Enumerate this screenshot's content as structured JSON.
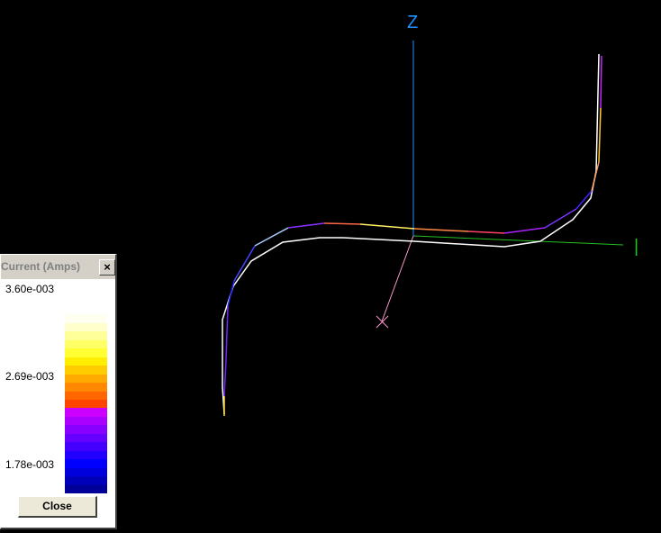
{
  "axes": {
    "z_label": "Z",
    "y_label": "Y",
    "x_label": "X",
    "z_color": "#1e90ff",
    "y_color": "#22c022",
    "x_color": "#ff99cc"
  },
  "legend": {
    "title": "Current (Amps)",
    "close_x": "×",
    "max_label": "3.60e-003",
    "mid_label": "2.69e-003",
    "min_label": "1.78e-003",
    "close_button": "Close",
    "colors_top_to_bottom": [
      "#ffffff",
      "#fffff0",
      "#ffffcc",
      "#ffff99",
      "#ffff66",
      "#ffff33",
      "#ffee00",
      "#ffcc00",
      "#ffaa00",
      "#ff8800",
      "#ff6600",
      "#ff4400",
      "#cc00ff",
      "#aa00ff",
      "#8800ff",
      "#6600ff",
      "#4400ff",
      "#2200ff",
      "#0000ff",
      "#0000dd",
      "#0000bb",
      "#000099"
    ]
  },
  "antenna": {
    "wire_color": "#ffffff"
  }
}
